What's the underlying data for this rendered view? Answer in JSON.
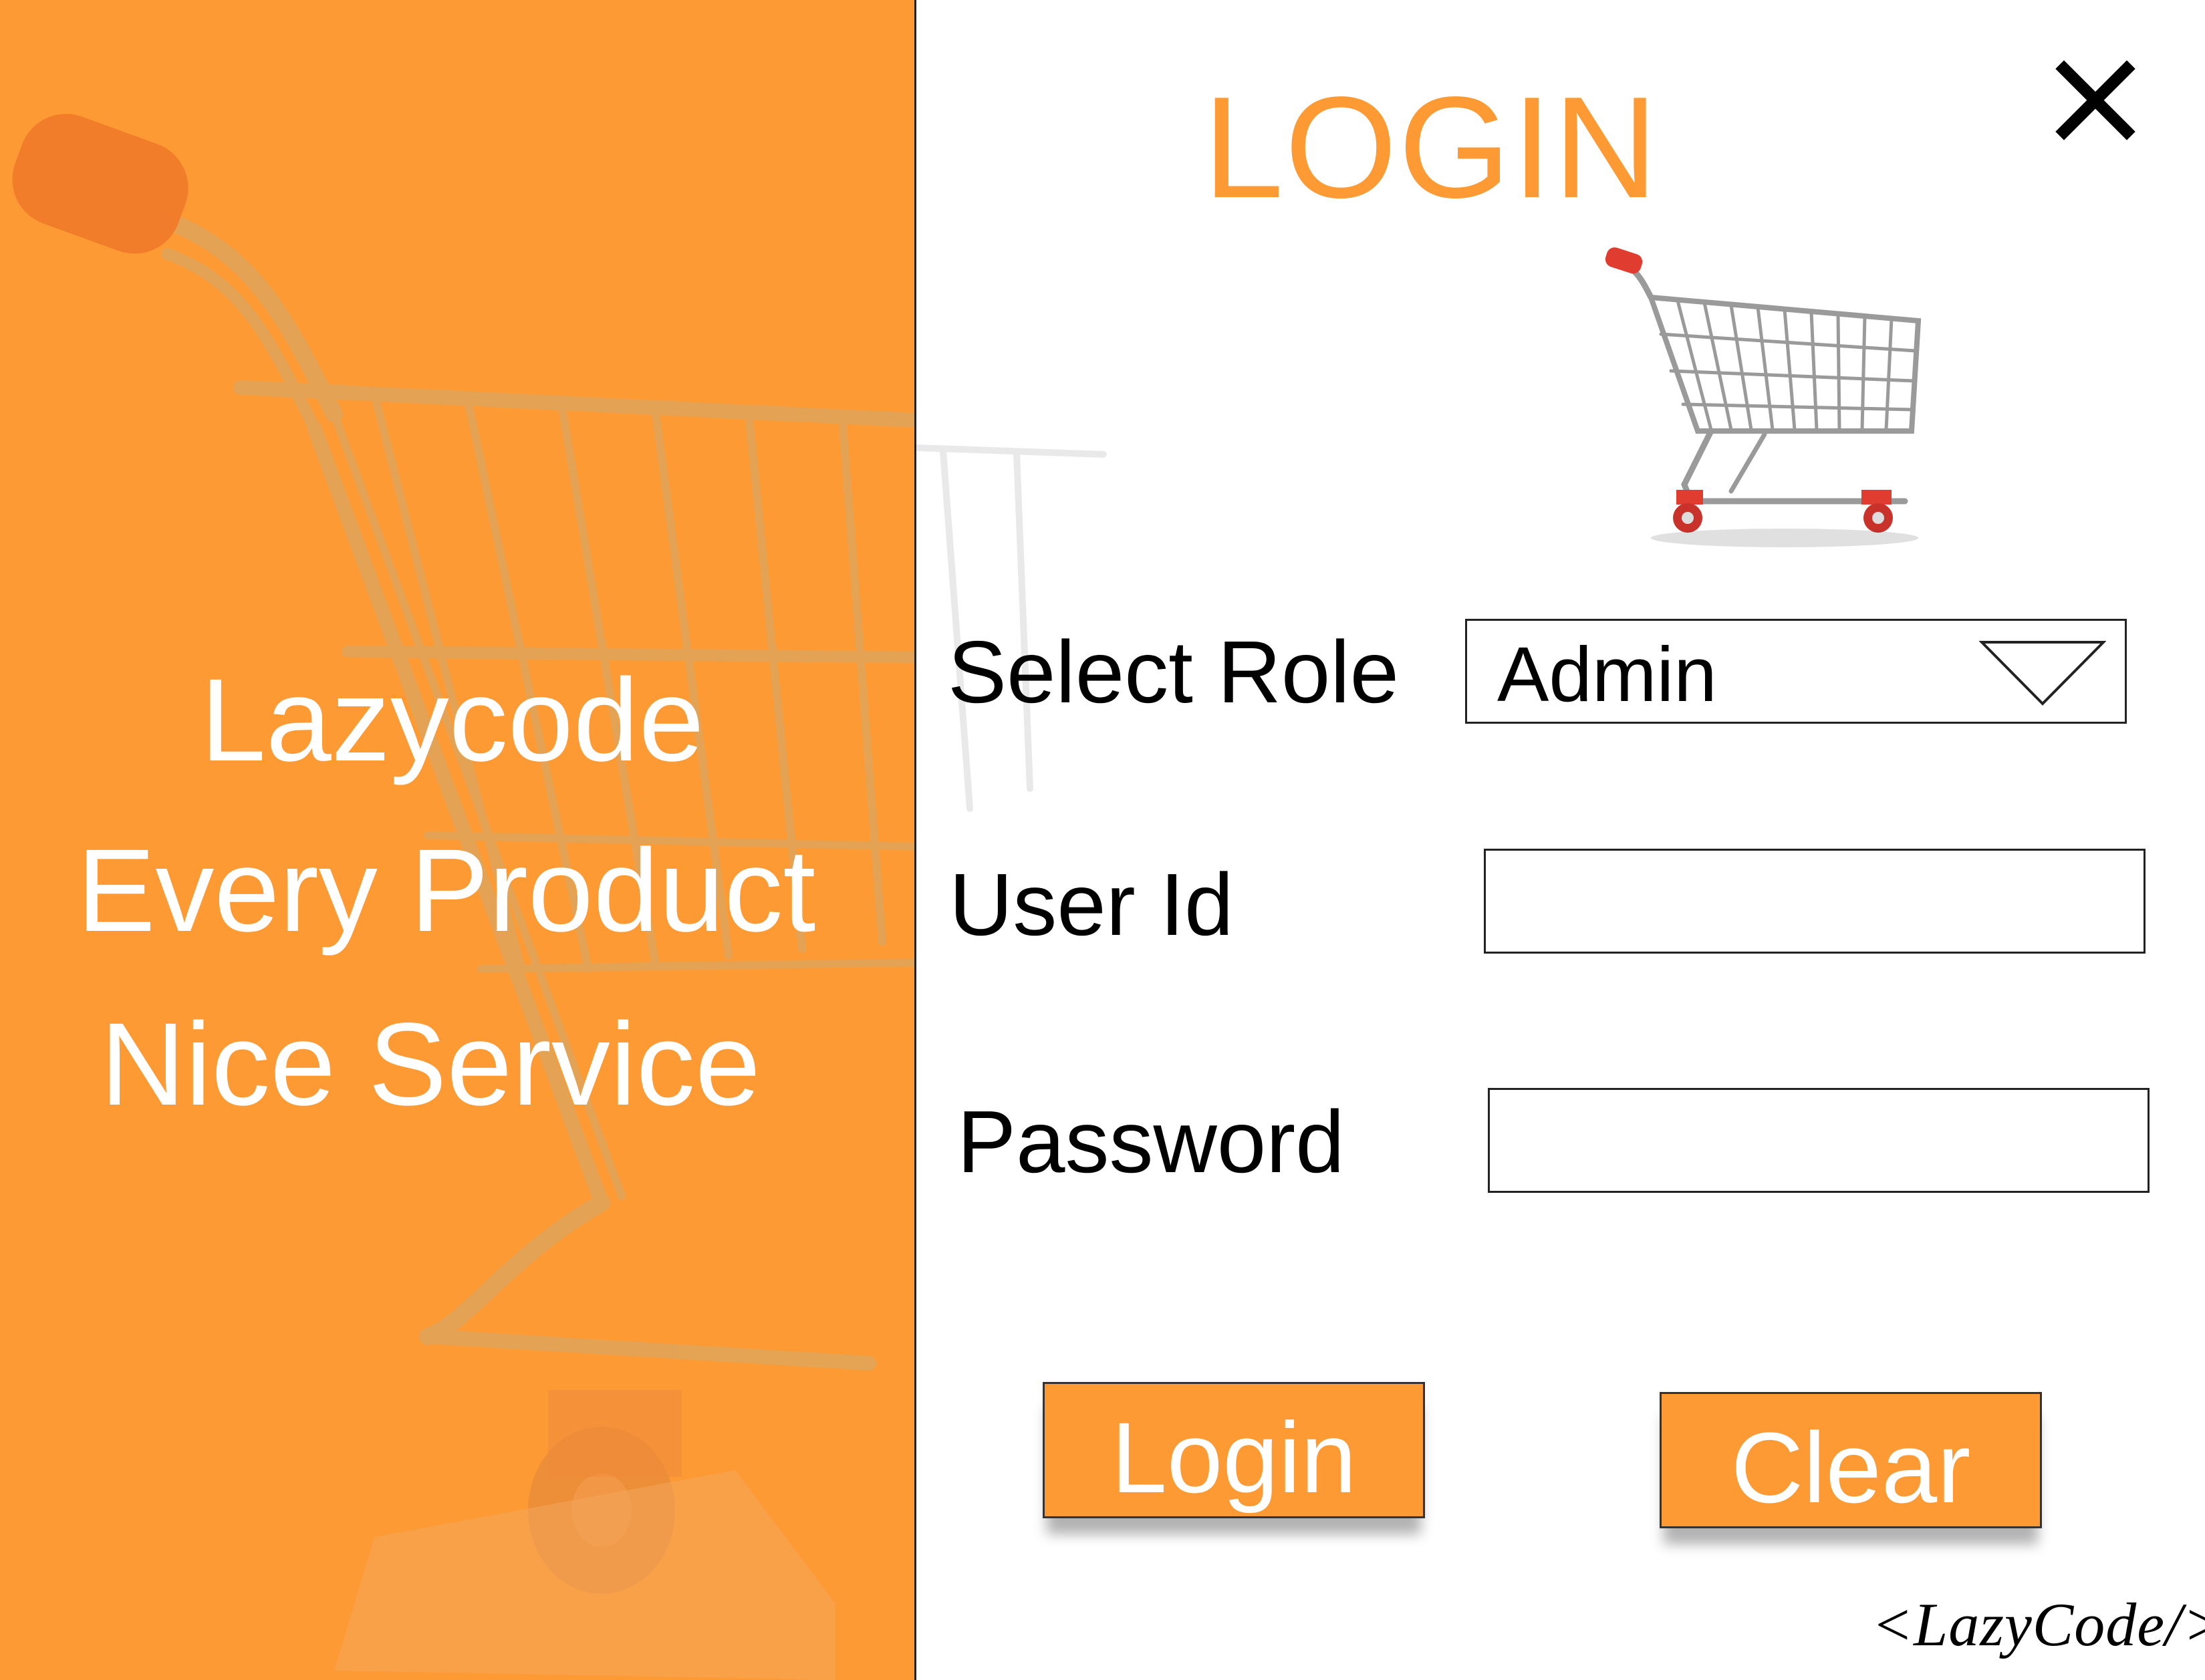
{
  "window": {
    "title": "LOGIN",
    "close_label": "X"
  },
  "side_panel": {
    "background_color": "#fd9a33",
    "slogan_lines": [
      "Lazycode",
      "Every Product",
      "Nice Service"
    ]
  },
  "form": {
    "role": {
      "label": "Select Role",
      "selected_value": "Admin"
    },
    "user_id": {
      "label": "User Id",
      "value": "",
      "placeholder": ""
    },
    "password": {
      "label": "Password",
      "value": "",
      "placeholder": ""
    }
  },
  "buttons": {
    "login_label": "Login",
    "clear_label": "Clear"
  },
  "footer": {
    "watermark": "<LazyCode/>"
  },
  "icons": {
    "close": "close-icon",
    "cart_logo": "shopping-cart-icon",
    "dropdown": "chevron-down-icon"
  },
  "colors": {
    "accent": "#fd9a33",
    "text": "#000000",
    "on_accent": "#ffffff"
  }
}
